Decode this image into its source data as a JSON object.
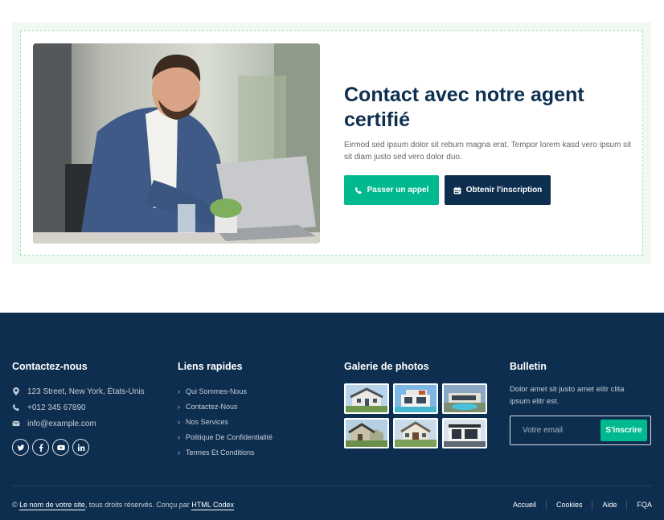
{
  "cta": {
    "title": "Contact avec notre agent certifié",
    "text": "Eirmod sed ipsum dolor sit rebum magna erat. Tempor lorem kasd vero ipsum sit sit diam justo sed vero dolor duo.",
    "call_label": "Passer un appel",
    "appointment_label": "Obtenir l'inscription",
    "call_icon": "phone-icon",
    "appointment_icon": "calendar-icon"
  },
  "footer": {
    "contact": {
      "heading": "Contactez-nous",
      "address": "123 Street, New York, États-Unis",
      "phone": "+012 345 67890",
      "email": "info@example.com",
      "socials": [
        "twitter-icon",
        "facebook-icon",
        "youtube-icon",
        "linkedin-icon"
      ]
    },
    "links": {
      "heading": "Liens rapides",
      "items": [
        "Qui Sommes-Nous",
        "Contactez-Nous",
        "Nos Services",
        "Politique De Confidentialité",
        "Termes Et Conditions"
      ]
    },
    "gallery": {
      "heading": "Galerie de photos"
    },
    "newsletter": {
      "heading": "Bulletin",
      "text": "Dolor amet sit justo amet elitr clita ipsum elitr est.",
      "placeholder": "Votre email",
      "button": "S'inscrire"
    },
    "copyright": {
      "prefix": "©",
      "site_name": "Le nom de votre site",
      "rights": ", tous droits réservés. Conçu par",
      "designer": "HTML Codex"
    },
    "menu": [
      "Accueil",
      "Cookies",
      "Aide",
      "FQA"
    ]
  },
  "colors": {
    "primary": "#00b98e",
    "dark": "#0e2e50",
    "light_bg": "#eff9f1"
  }
}
